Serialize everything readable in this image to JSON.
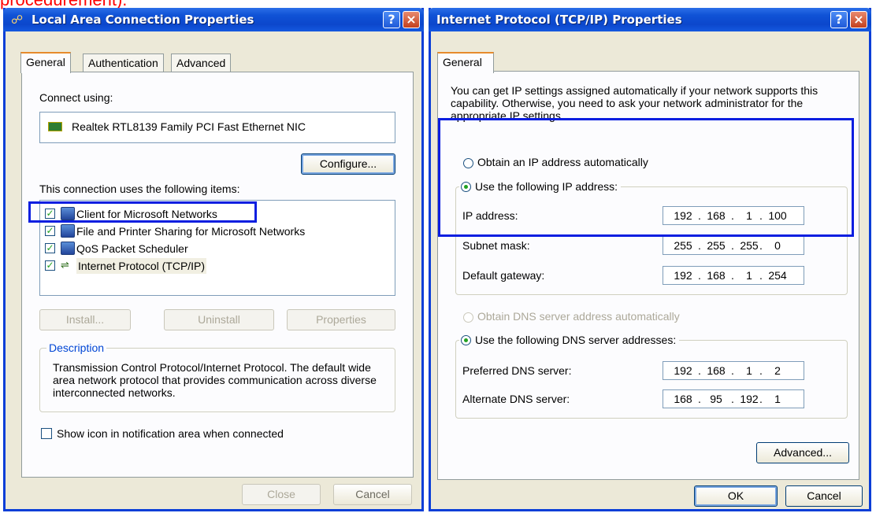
{
  "top_fragment": "procedurement).",
  "win1": {
    "title": "Local Area Connection Properties",
    "help_label": "?",
    "close_label": "×",
    "tabs": [
      "General",
      "Authentication",
      "Advanced"
    ],
    "connect_using_label": "Connect using:",
    "nic_name": "Realtek RTL8139 Family PCI Fast Ethernet NIC",
    "configure_label": "Configure...",
    "items_label": "This connection uses the following items:",
    "items": [
      {
        "label": "Client for Microsoft Networks",
        "checked": true
      },
      {
        "label": "File and Printer Sharing for Microsoft Networks",
        "checked": true
      },
      {
        "label": "QoS Packet Scheduler",
        "checked": true
      },
      {
        "label": "Internet Protocol (TCP/IP)",
        "checked": true
      }
    ],
    "install_label": "Install...",
    "uninstall_label": "Uninstall",
    "properties_label": "Properties",
    "description_legend": "Description",
    "description_text": "Transmission Control Protocol/Internet Protocol. The default wide area network protocol that provides communication across diverse interconnected networks.",
    "show_icon_label": "Show icon in notification area when connected",
    "show_icon_checked": false,
    "close_button": "Close",
    "cancel_button": "Cancel"
  },
  "win2": {
    "title": "Internet Protocol (TCP/IP) Properties",
    "help_label": "?",
    "close_label": "×",
    "tabs": [
      "General"
    ],
    "intro": "You can get IP settings assigned automatically if your network supports this capability. Otherwise, you need to ask your network administrator for the appropriate IP settings.",
    "obtain_ip_label": "Obtain an IP address automatically",
    "use_ip_label": "Use the following IP address:",
    "ip_label": "IP address:",
    "ip": [
      "192",
      "168",
      "1",
      "100"
    ],
    "subnet_label": "Subnet mask:",
    "subnet": [
      "255",
      "255",
      "255",
      "0"
    ],
    "gateway_label": "Default gateway:",
    "gateway": [
      "192",
      "168",
      "1",
      "254"
    ],
    "obtain_dns_label": "Obtain DNS server address automatically",
    "use_dns_label": "Use the following DNS server addresses:",
    "preferred_dns_label": "Preferred DNS server:",
    "preferred_dns": [
      "192",
      "168",
      "1",
      "2"
    ],
    "alternate_dns_label": "Alternate DNS server:",
    "alternate_dns": [
      "168",
      "95",
      "192",
      "1"
    ],
    "advanced_label": "Advanced...",
    "ok_label": "OK",
    "cancel_label": "Cancel"
  },
  "colors": {
    "titlebar": "#0b47cc",
    "highlight_box": "#0a1ee0",
    "dialog_bg": "#ece9d8",
    "annotation_text": "#ff0000"
  }
}
